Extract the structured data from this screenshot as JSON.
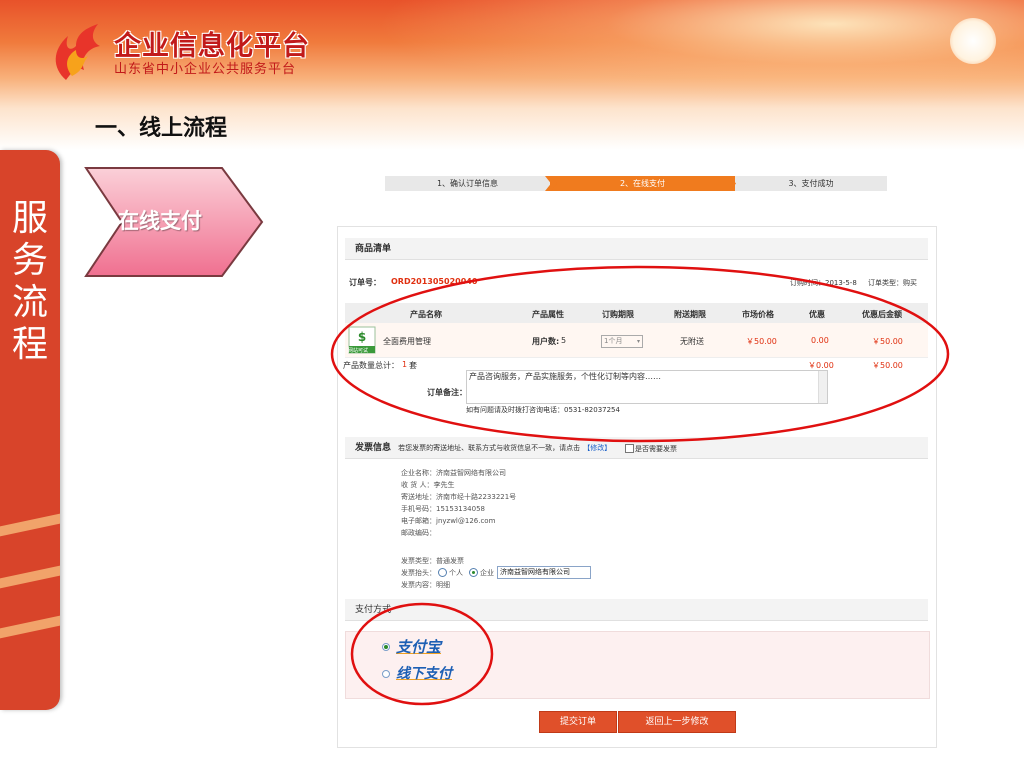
{
  "brand": {
    "title": "企业信息化平台",
    "subtitle": "山东省中小企业公共服务平台"
  },
  "section_title": "一、线上流程",
  "side_label": [
    "服",
    "务",
    "流",
    "程"
  ],
  "chevron_label": "在线支付",
  "steps": [
    "1、确认订单信息",
    "2、在线支付",
    "3、支付成功"
  ],
  "goods": {
    "header": "商品清单",
    "order_no_label": "订单号：",
    "order_no": "ORD201305020040",
    "order_time": "订购时间：2013-5-8",
    "order_type": "订单类型：购买",
    "columns": [
      "产品名称",
      "产品属性",
      "订购期限",
      "附送期限",
      "市场价格",
      "优惠",
      "优惠后金额"
    ],
    "row": {
      "name": "全面费用管理",
      "attr_label": "用户数:",
      "attr_value": "5",
      "period": "1个月",
      "gift": "无附送",
      "price": "￥50.00",
      "discount": "0.00",
      "final": "￥50.00",
      "badge": "网站可试"
    },
    "total_label": "产品数量总计：",
    "total_count": "1",
    "total_unit": "套",
    "total_discount": "￥0.00",
    "total_final": "￥50.00",
    "remark_label": "订单备注：",
    "remark_text": "产品咨询服务，产品实施服务，个性化订制等内容……",
    "hotline": "如有问题请及时拨打咨询电话：0531-82037254"
  },
  "invoice": {
    "header": "发票信息",
    "note": "若您发票的寄送地址、联系方式与收货信息不一致，请点击",
    "modify_link": "【修改】",
    "need_invoice": "是否需要发票",
    "lines": [
      "企业名称：济南益智网络有限公司",
      "收 货 人：李先生",
      "寄送地址：济南市经十路2233221号",
      "手机号码：15153134058",
      "电子邮箱：jnyzwl@126.com",
      "邮政编码："
    ],
    "type_line": "发票类型：普通发票",
    "title_label": "发票抬头：",
    "opt_person": "个人",
    "opt_company": "企业",
    "company_value": "济南益智网络有限公司",
    "content_line": "发票内容：明细"
  },
  "payment": {
    "header": "支付方式",
    "alipay": "支付宝",
    "offline": "线下支付"
  },
  "buttons": {
    "submit": "提交订单",
    "back": "返回上一步修改"
  },
  "colors": {
    "accent": "#f07b1e",
    "banner": "#e8522a",
    "annotation": "#e01010"
  }
}
